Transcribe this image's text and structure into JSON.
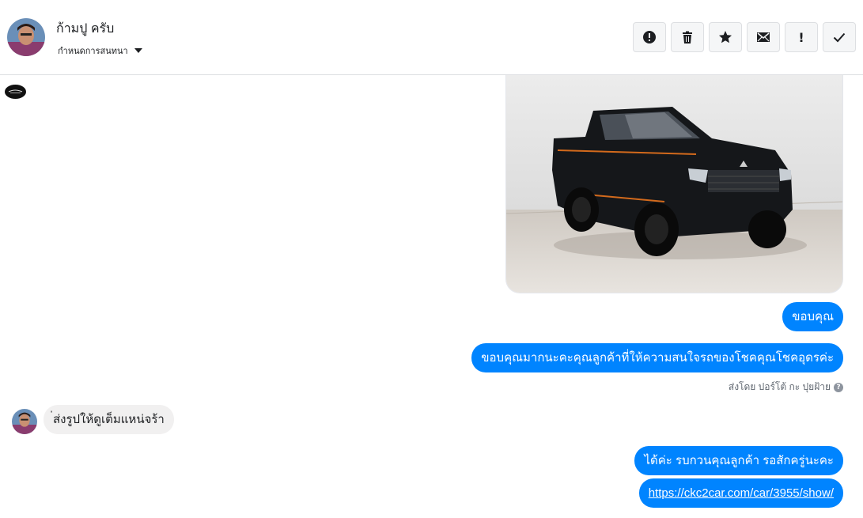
{
  "header": {
    "contact_name": "ก้ามปู ครับ",
    "assign_label": "กำหนดการสนทนา"
  },
  "toolbar": {
    "buttons": [
      {
        "icon": "alert-circle-icon",
        "label": "Mark as spam"
      },
      {
        "icon": "trash-icon",
        "label": "Delete"
      },
      {
        "icon": "star-icon",
        "label": "Star"
      },
      {
        "icon": "envelope-icon",
        "label": "Mark as unread"
      },
      {
        "icon": "exclamation-icon",
        "label": "!"
      },
      {
        "icon": "checkmark-icon",
        "label": "Mark as done"
      }
    ]
  },
  "messages": {
    "out_1": "ขอบคุณ",
    "out_2": "ขอบคุณมากนะคะคุณลูกค้าที่ให้ความสนใจรถของโชคคุณโชคอุดรค่ะ",
    "sent_by": "ส่งโดย ปอร์โต้ กะ ปุยฝ้าย",
    "in_1": "่ส่งรูปให้ดูเต็มแหน่จร้า",
    "out_3": "ได้ค่ะ รบกวนคุณลูกค้า รอสักครู่นะคะ",
    "out_4_link": "https://ckc2car.com/car/3955/show/"
  },
  "colors": {
    "outgoing_bubble": "#0084ff",
    "incoming_bubble": "#f1f0f0",
    "border": "#dddfe2"
  }
}
